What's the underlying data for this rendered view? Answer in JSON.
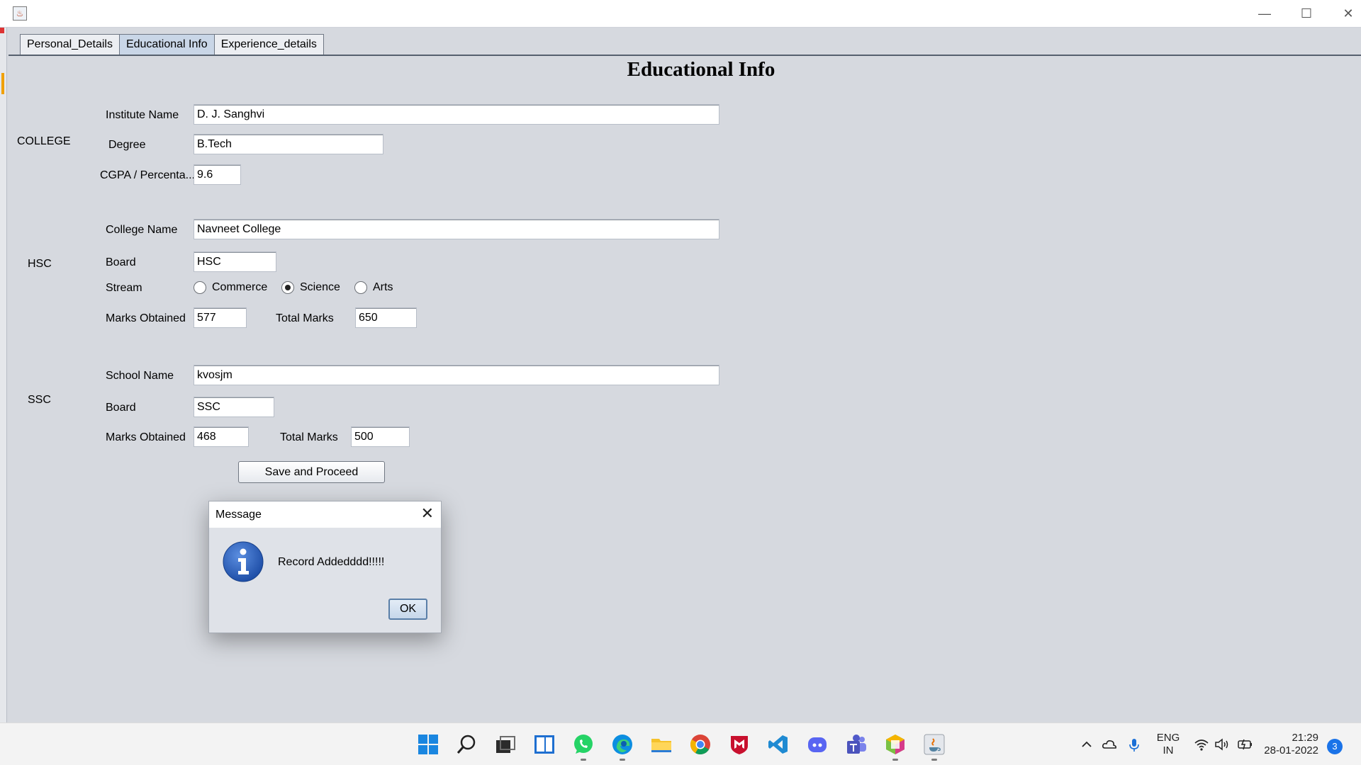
{
  "window": {
    "app_icon": "java-app-icon",
    "minimize": "—",
    "maximize": "☐",
    "close": "✕"
  },
  "tabs": [
    {
      "label": "Personal_Details"
    },
    {
      "label": "Educational Info"
    },
    {
      "label": "Experience_details"
    }
  ],
  "form": {
    "title": "Educational Info",
    "college": {
      "section_label": "COLLEGE",
      "institute_label": "Institute Name",
      "institute_value": "D. J. Sanghvi",
      "degree_label": "Degree",
      "degree_value": "B.Tech",
      "cgpa_label": "CGPA / Percenta...",
      "cgpa_value": "9.6"
    },
    "hsc": {
      "section_label": "HSC",
      "college_label": "College Name",
      "college_value": "Navneet College",
      "board_label": "Board",
      "board_value": "HSC",
      "stream_label": "Stream",
      "stream_options": [
        "Commerce",
        "Science",
        "Arts"
      ],
      "stream_selected": "Science",
      "marks_label": "Marks Obtained",
      "marks_value": "577",
      "total_label": "Total Marks",
      "total_value": "650"
    },
    "ssc": {
      "section_label": "SSC",
      "school_label": "School Name",
      "school_value": "kvosjm",
      "board_label": "Board",
      "board_value": "SSC",
      "marks_label": "Marks Obtained",
      "marks_value": "468",
      "total_label": "Total Marks",
      "total_value": "500"
    },
    "save_button": "Save and Proceed"
  },
  "dialog": {
    "title": "Message",
    "message": "Record Addedddd!!!!!",
    "ok": "OK",
    "icon": "info-icon"
  },
  "taskbar": {
    "apps": [
      "start-icon",
      "search-icon",
      "task-view-icon",
      "widgets-icon",
      "whatsapp-icon",
      "edge-icon",
      "file-explorer-icon",
      "chrome-icon",
      "mcafee-icon",
      "vscode-icon",
      "discord-icon",
      "teams-icon",
      "app-cube-icon",
      "java-icon"
    ],
    "lang_line1": "ENG",
    "lang_line2": "IN",
    "time": "21:29",
    "date": "28-01-2022",
    "notifications": "3"
  }
}
